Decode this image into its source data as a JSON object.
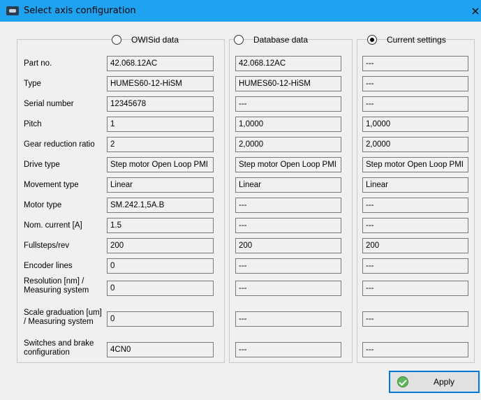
{
  "window": {
    "title": "Select axis configuration",
    "close_glyph": "×"
  },
  "sources": [
    {
      "label": "OWISid data",
      "checked": false
    },
    {
      "label": "Database data",
      "checked": false
    },
    {
      "label": "Current settings",
      "checked": true
    }
  ],
  "rows": [
    {
      "label": "Part no.",
      "values": [
        "42.068.12AC",
        "42.068.12AC",
        "---"
      ]
    },
    {
      "label": "Type",
      "values": [
        "HUMES60-12-HiSM",
        "HUMES60-12-HiSM",
        "---"
      ]
    },
    {
      "label": "Serial number",
      "values": [
        "12345678",
        "---",
        "---"
      ]
    },
    {
      "label": "Pitch",
      "values": [
        "1",
        "1,0000",
        "1,0000"
      ]
    },
    {
      "label": "Gear reduction ratio",
      "values": [
        "2",
        "2,0000",
        "2,0000"
      ]
    },
    {
      "label": "Drive type",
      "values": [
        "Step motor Open Loop PMI",
        "Step motor Open Loop PMI",
        "Step motor Open Loop PMI"
      ]
    },
    {
      "label": "Movement type",
      "values": [
        "Linear",
        "Linear",
        "Linear"
      ]
    },
    {
      "label": "Motor type",
      "values": [
        "SM.242.1,5A.B",
        "---",
        "---"
      ]
    },
    {
      "label": "Nom. current [A]",
      "values": [
        "1.5",
        "---",
        "---"
      ]
    },
    {
      "label": "Fullsteps/rev",
      "values": [
        "200",
        "200",
        "200"
      ]
    },
    {
      "label": "Encoder lines",
      "values": [
        "0",
        "---",
        "---"
      ]
    },
    {
      "label": "Resolution [nm] / Measuring system",
      "values": [
        "0",
        "---",
        "---"
      ]
    },
    {
      "label": "Scale graduation [um] / Measuring system",
      "values": [
        "0",
        "---",
        "---"
      ]
    },
    {
      "label": "Switches and brake configuration",
      "values": [
        "4CN0",
        "---",
        "---"
      ]
    }
  ],
  "apply": {
    "label": "Apply",
    "icon": "check-circle-icon",
    "icon_color": "#5cb85c"
  },
  "colors": {
    "titlebar": "#1fa3f0",
    "focus_border": "#0078d7"
  }
}
